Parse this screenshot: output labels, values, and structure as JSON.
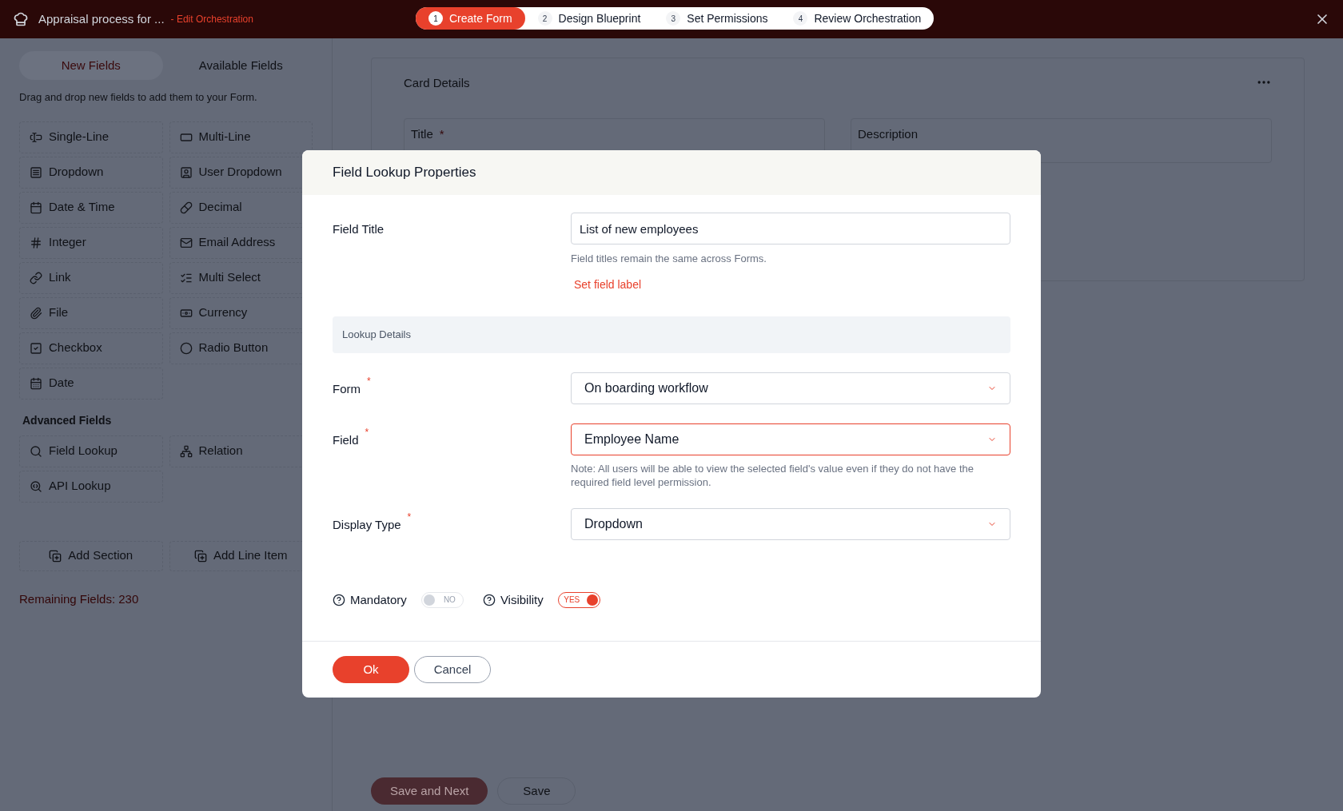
{
  "header": {
    "title": "Appraisal process for ...",
    "subtitle": "- Edit Orchestration"
  },
  "steps": [
    {
      "number": "1",
      "label": "Create Form",
      "selected": true
    },
    {
      "number": "2",
      "label": "Design Blueprint",
      "selected": false
    },
    {
      "number": "3",
      "label": "Set Permissions",
      "selected": false
    },
    {
      "number": "4",
      "label": "Review Orchestration",
      "selected": false
    }
  ],
  "sidebar": {
    "tabs": [
      {
        "label": "New Fields",
        "selected": true
      },
      {
        "label": "Available Fields",
        "selected": false
      }
    ],
    "hint": "Drag and drop new fields to add them to your Form.",
    "fields": [
      "Single-Line",
      "Multi-Line",
      "Dropdown",
      "User Dropdown",
      "Date & Time",
      "Decimal",
      "Integer",
      "Email Address",
      "Link",
      "Multi Select",
      "File",
      "Currency",
      "Checkbox",
      "Radio Button",
      "Date"
    ],
    "advanced_title": "Advanced Fields",
    "advanced_fields": [
      "Field Lookup",
      "Relation",
      "API Lookup"
    ],
    "actions": [
      "Add Section",
      "Add Line Item"
    ],
    "remaining": "Remaining Fields: 230"
  },
  "card": {
    "title": "Card Details",
    "fields": [
      {
        "label": "Title",
        "required_mark": "*"
      },
      {
        "label": "Description"
      }
    ]
  },
  "footer_buttons": [
    "Save and Next",
    "Save"
  ],
  "dialog": {
    "title": "Field Lookup Properties",
    "field_title": {
      "label": "Field Title",
      "value": "List of new employees",
      "hint": "Field titles remain the same across Forms.",
      "link": "Set field label"
    },
    "section": "Lookup Details",
    "rows": [
      {
        "label": "Form",
        "required_mark": "*",
        "value": "On boarding workflow",
        "active": false
      },
      {
        "label": "Field",
        "required_mark": "*",
        "value": "Employee Name",
        "active": true,
        "note": "Note: All users will be able to view the selected field's value even if they do not have the required field level permission."
      },
      {
        "label": "Display Type",
        "required_mark": "*",
        "value": "Dropdown",
        "active": false
      }
    ],
    "toggles": [
      {
        "label": "Mandatory",
        "on": false,
        "text": "NO"
      },
      {
        "label": "Visibility",
        "on": true,
        "text": "YES"
      }
    ],
    "buttons": [
      "Ok",
      "Cancel"
    ]
  }
}
